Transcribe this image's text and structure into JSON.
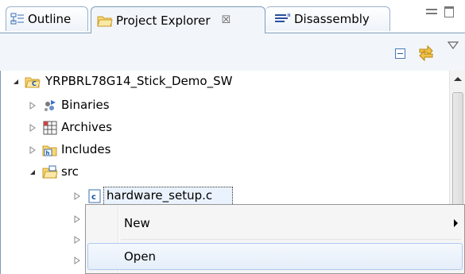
{
  "tabs": [
    {
      "label": "Outline",
      "icon": "outline-icon",
      "active": false
    },
    {
      "label": "Project Explorer",
      "icon": "project-explorer-icon",
      "active": true,
      "close_glyph": "☒"
    },
    {
      "label": "Disassembly",
      "icon": "disassembly-icon",
      "active": false
    }
  ],
  "tree": {
    "root": {
      "label": "YRPBRL78G14_Stick_Demo_SW",
      "expanded": true
    },
    "children": [
      {
        "label": "Binaries",
        "expanded": false
      },
      {
        "label": "Archives",
        "expanded": false
      },
      {
        "label": "Includes",
        "expanded": false
      },
      {
        "label": "src",
        "expanded": true
      }
    ],
    "src_children": [
      {
        "label": "hardware_setup.c",
        "selected": true
      }
    ]
  },
  "context_menu": {
    "items": [
      {
        "label": "New",
        "has_submenu": true
      },
      {
        "label": "Open",
        "hovered": true
      }
    ]
  },
  "colors": {
    "accent_border": "#7f9db9",
    "toolbar_bg": "#f2f6fb",
    "menu_hover_border": "#aecbef"
  }
}
